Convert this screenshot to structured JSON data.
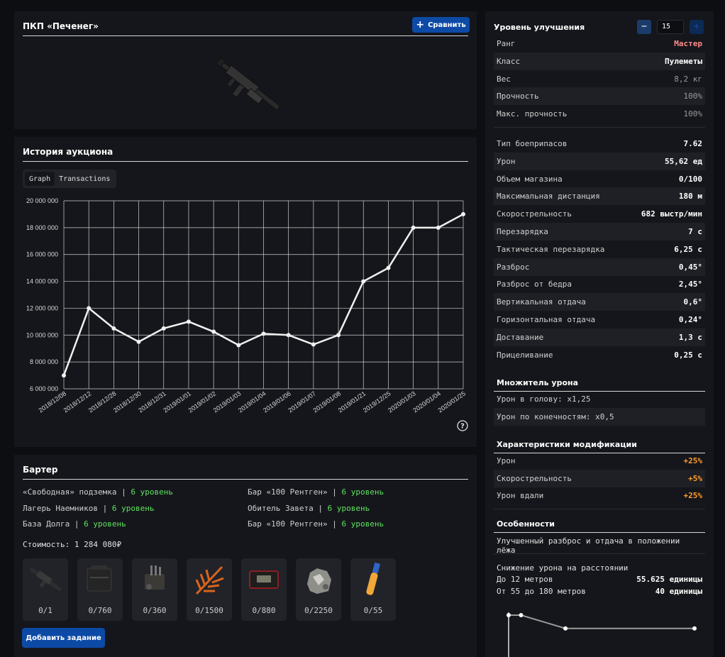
{
  "header": {
    "title": "ПКП «Печенег»",
    "compare_label": "Сравнить"
  },
  "auction": {
    "title": "История аукциона",
    "tabs": [
      "Graph",
      "Transactions"
    ]
  },
  "chart_data": {
    "type": "line",
    "title": "",
    "xlabel": "",
    "ylabel": "",
    "categories": [
      "2018/12/08",
      "2018/12/12",
      "2018/12/28",
      "2018/12/30",
      "2018/12/31",
      "2019/01/01",
      "2019/01/02",
      "2019/01/03",
      "2019/01/04",
      "2019/01/06",
      "2019/01/07",
      "2019/01/08",
      "2019/01/21",
      "2019/12/25",
      "2020/01/03",
      "2020/01/04",
      "2020/01/25"
    ],
    "values": [
      7000000,
      12000000,
      10500000,
      9500000,
      10500000,
      11000000,
      10250000,
      9250000,
      10100000,
      10000000,
      9300000,
      10000000,
      14000000,
      15000000,
      18000000,
      18000000,
      19000000
    ],
    "ylim": [
      6000000,
      20000000
    ],
    "yticks": [
      "6 000 000",
      "8 000 000",
      "10 000 000",
      "12 000 000",
      "14 000 000",
      "16 000 000",
      "18 000 000",
      "20 000 000"
    ],
    "grid": true,
    "line_color": "#f0f0f0"
  },
  "help_icon": "question-circle-icon",
  "barter": {
    "title": "Бартер",
    "left": [
      {
        "place": "«Свободная» подземка",
        "level": "6 уровень"
      },
      {
        "place": "Лагерь Наемников",
        "level": "6 уровень"
      },
      {
        "place": "База Долга",
        "level": "6 уровень"
      }
    ],
    "right": [
      {
        "place": "Бар «100 Рентген»",
        "level": "6 уровень"
      },
      {
        "place": "Обитель Завета",
        "level": "6 уровень"
      },
      {
        "place": "Бар «100 Рентген»",
        "level": "6 уровень"
      }
    ],
    "separator": "|",
    "cost": "Стоимость: 1 284 080₽",
    "items": [
      {
        "icon": "rifle-icon",
        "count": "0/1"
      },
      {
        "icon": "ammo-box-icon",
        "count": "0/760"
      },
      {
        "icon": "mechanism-icon",
        "count": "0/360"
      },
      {
        "icon": "fern-icon",
        "count": "0/1500"
      },
      {
        "icon": "case-icon",
        "count": "0/880"
      },
      {
        "icon": "ore-icon",
        "count": "0/2250"
      },
      {
        "icon": "vial-icon",
        "count": "0/55"
      }
    ],
    "add_task": "Добавить задание"
  },
  "upgrade": {
    "label": "Уровень улучшения",
    "minus": "−",
    "value": "15",
    "plus": "+"
  },
  "basic": [
    {
      "label": "Ранг",
      "value": "Мастер",
      "style": "rank"
    },
    {
      "label": "Класс",
      "value": "Пулеметы",
      "style": ""
    },
    {
      "label": "Вес",
      "value": "8,2 кг",
      "style": "dim"
    },
    {
      "label": "Прочность",
      "value": "100%",
      "style": "dim"
    },
    {
      "label": "Макс. прочность",
      "value": "100%",
      "style": "dim"
    }
  ],
  "stats": [
    {
      "label": "Тип боеприпасов",
      "value": "7.62"
    },
    {
      "label": "Урон",
      "value": "55,62 ед"
    },
    {
      "label": "Объем магазина",
      "value": "0/100"
    },
    {
      "label": "Максимальная дистанция",
      "value": "180 м"
    },
    {
      "label": "Скорострельность",
      "value": "682 выстр/мин"
    },
    {
      "label": "Перезарядка",
      "value": "7 с"
    },
    {
      "label": "Тактическая перезарядка",
      "value": "6,25 с"
    },
    {
      "label": "Разброс",
      "value": "0,45°"
    },
    {
      "label": "Разброс от бедра",
      "value": "2,45°"
    },
    {
      "label": "Вертикальная отдача",
      "value": "0,6°"
    },
    {
      "label": "Горизонтальная отдача",
      "value": "0,24°"
    },
    {
      "label": "Доставание",
      "value": "1,3 с"
    },
    {
      "label": "Прицеливание",
      "value": "0,25 с"
    }
  ],
  "damage_mult": {
    "title": "Множитель урона",
    "head": "Урон в голову: x1,25",
    "limbs": "Урон по конечностям: x0,5"
  },
  "mods": {
    "title": "Характеристики модификации",
    "rows": [
      {
        "label": "Урон",
        "value": "+25%"
      },
      {
        "label": "Скорострельность",
        "value": "+5%"
      },
      {
        "label": "Урон вдали",
        "value": "+25%"
      }
    ]
  },
  "features": {
    "title": "Особенности",
    "text": "Улучшенный разброс и отдача в положении лёжа"
  },
  "falloff": {
    "title": "Снижение урона на расстоянии",
    "rows": [
      {
        "label": "До 12 метров",
        "value": "55.625 единицы"
      },
      {
        "label": "От 55 до 180 метров",
        "value": "40 единицы"
      }
    ],
    "curve": [
      {
        "distance": 0,
        "damage": 55.625
      },
      {
        "distance": 12,
        "damage": 55.625
      },
      {
        "distance": 55,
        "damage": 40
      },
      {
        "distance": 180,
        "damage": 40
      }
    ]
  }
}
